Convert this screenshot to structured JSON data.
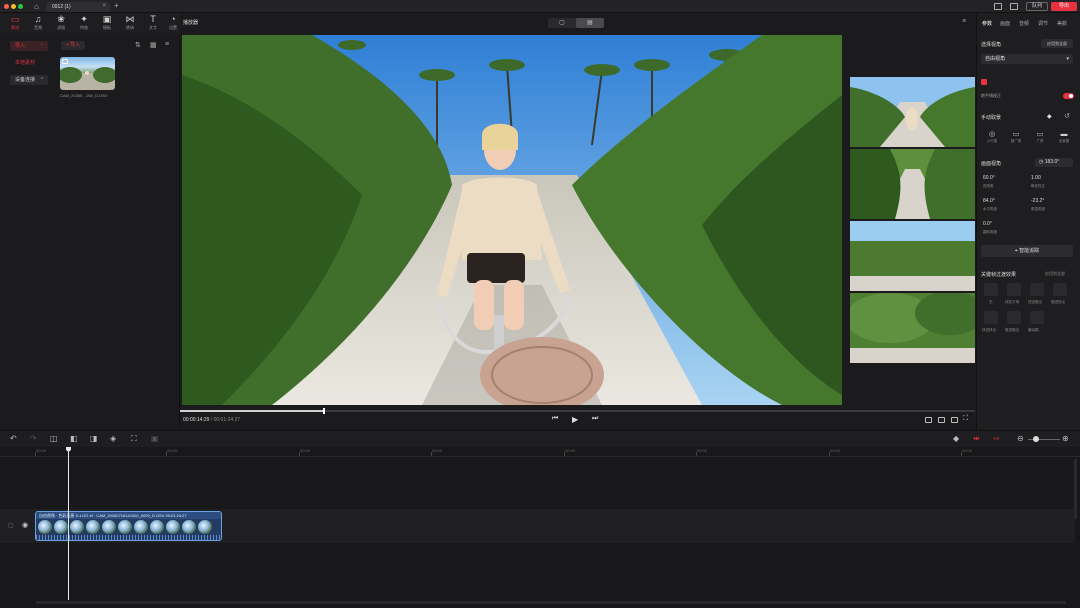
{
  "window": {
    "tab_title": "0912 (1)",
    "queue_label": "队列",
    "export_label": "导出"
  },
  "toolbar": {
    "items": [
      {
        "icon": "folder-icon",
        "glyph": "▭",
        "label": "素材"
      },
      {
        "icon": "music-icon",
        "glyph": "♫",
        "label": "音频"
      },
      {
        "icon": "filter-icon",
        "glyph": "❀",
        "label": "滤镜"
      },
      {
        "icon": "effects-icon",
        "glyph": "✦",
        "label": "特效"
      },
      {
        "icon": "template-icon",
        "glyph": "▣",
        "label": "模板"
      },
      {
        "icon": "transition-icon",
        "glyph": "⋈",
        "label": "转场"
      },
      {
        "icon": "text-icon",
        "glyph": "T",
        "label": "文字"
      },
      {
        "icon": "settings-icon",
        "glyph": "◔",
        "label": "设置"
      }
    ]
  },
  "left": {
    "import_tab": "导入",
    "local_media": "本地素材",
    "device_connect": "设备连接",
    "import_button": "+ 导入",
    "clip_name": "CAM_20260…000_D.OSV"
  },
  "preview": {
    "title": "播放器",
    "current_time": "00:00:14:29",
    "duration": "/ 00:01:24:27",
    "progress": 0.18
  },
  "right": {
    "tabs": [
      "参数",
      "画面",
      "音频",
      "调节",
      "美颜"
    ],
    "view_section": "选择视角",
    "apply_all": "应用到全部",
    "view_mode": "自由视角",
    "horizon_label": "地平线校正",
    "manual_section": "手动取景",
    "lens_items": [
      "小行星",
      "超广角",
      "广角",
      "全景图"
    ],
    "fov_section": "画面视角",
    "fov_value": "183.0°",
    "params": [
      {
        "value": "60.0°",
        "label": "视场角"
      },
      {
        "value": "1.00",
        "label": "畸变校正"
      },
      {
        "value": "84.0°",
        "label": "水平角度"
      },
      {
        "value": "-23.2°",
        "label": "垂直角度"
      },
      {
        "value": "0.0°",
        "label": "翻转角度"
      }
    ],
    "smart_track": "智能追踪",
    "keyframe_section": "关键帧过渡效果",
    "keyframe_apply": "应用到全部",
    "curves": [
      "无",
      "线性平滑",
      "快进慢出",
      "慢进快出",
      "快进快出",
      "慢进慢出",
      "缓动模..."
    ]
  },
  "timeline": {
    "ruler": [
      "00:00",
      "00:00",
      "00:00",
      "00:00",
      "00:00",
      "00:00",
      "00:00",
      "00:00"
    ],
    "clip_label": "自由视角 · 色彩还原 D-LOG M · CAM_20260716141000_0009_D.OSV 00:01:24:27"
  }
}
